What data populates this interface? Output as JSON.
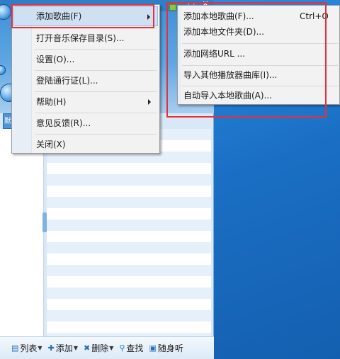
{
  "colors": {
    "annotation": "#e8303a",
    "highlight": "#cfe0f3",
    "menu_bg": "#f2f2f2",
    "accent": "#2c6fb5"
  },
  "player": {
    "controls": [
      "▭",
      "✕"
    ],
    "side_tab_label": "默"
  },
  "main_menu": {
    "items": [
      {
        "label": "添加歌曲(F)",
        "has_submenu": true,
        "highlighted": true
      },
      {
        "label": "打开音乐保存目录(S)...",
        "has_submenu": false
      },
      {
        "label": "设置(O)...",
        "has_submenu": false
      },
      {
        "label": "登陆通行证(L)...",
        "has_submenu": false
      },
      {
        "label": "帮助(H)",
        "has_submenu": true
      },
      {
        "label": "意见反馈(R)...",
        "has_submenu": false
      },
      {
        "label": "关闭(X)",
        "has_submenu": false
      }
    ]
  },
  "submenu": {
    "items": [
      {
        "label": "添加本地歌曲(F)...",
        "shortcut": "Ctrl+O"
      },
      {
        "label": "添加本地文件夹(D)..."
      },
      {
        "label": "添加网络URL ..."
      },
      {
        "label": "导入其他播放器曲库(I)..."
      },
      {
        "label": "自动导入本地歌曲(A)..."
      }
    ]
  },
  "toolbar": {
    "list_label": "列表",
    "add_label": "添加",
    "delete_label": "删除",
    "find_label": "查找",
    "portable_label": "随身听"
  }
}
